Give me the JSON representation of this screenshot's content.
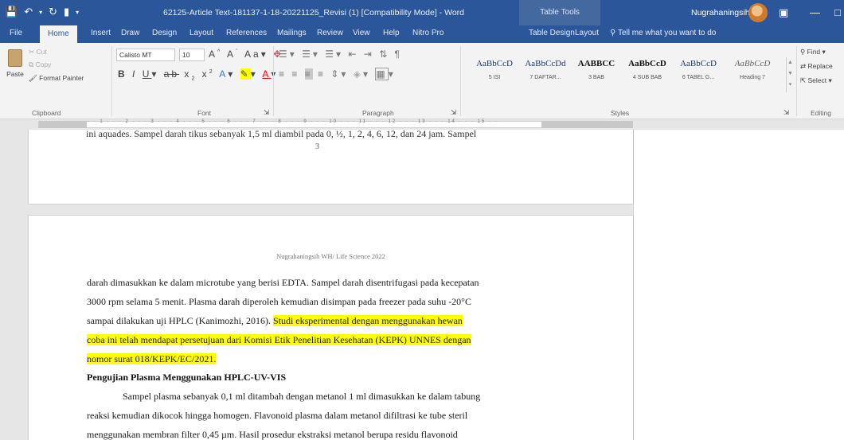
{
  "titlebar": {
    "document_title": "62125-Article Text-181137-1-18-20221125_Revisi (1) [Compatibility Mode] - Word",
    "table_tools": "Table Tools",
    "user_name": "Nugrahaningsih WH"
  },
  "tabs": [
    "File",
    "Home",
    "Insert",
    "Draw",
    "Design",
    "Layout",
    "References",
    "Mailings",
    "Review",
    "View",
    "Help",
    "Nitro Pro",
    "Table Design",
    "Layout"
  ],
  "active_tab": "Home",
  "tell_me": "Tell me what you want to do",
  "clipboard": {
    "paste": "Paste",
    "cut": "Cut",
    "copy": "Copy",
    "format_painter": "Format Painter",
    "label": "Clipboard"
  },
  "font": {
    "name": "Calisto MT",
    "size": "10",
    "label": "Font"
  },
  "paragraph": {
    "label": "Paragraph"
  },
  "styles": {
    "label": "Styles",
    "items": [
      {
        "sample": "AaBbCcD",
        "name": "5 ISI"
      },
      {
        "sample": "AaBbCcDd",
        "name": "7 DAFTAR..."
      },
      {
        "sample": "AABBCC",
        "name": "3 BAB"
      },
      {
        "sample": "AaBbCcD",
        "name": "4 SUB BAB"
      },
      {
        "sample": "AaBbCcD",
        "name": "6 TABEL G..."
      },
      {
        "sample": "AaBbCcD",
        "name": "Heading 7"
      }
    ]
  },
  "editing": {
    "find": "Find",
    "replace": "Replace",
    "select": "Select",
    "label": "Editing"
  },
  "document": {
    "page1_fragment": "ini aquades. Sampel darah tikus sebanyak 1,5 ml diambil pada 0, ½, 1, 2, 4, 6, 12, dan 24 jam. Sampel",
    "page1_number": "3",
    "header": "Nugrahaningsih WH/ Life Science 2022",
    "lines": [
      "darah dimasukkan ke dalam microtube yang berisi EDTA. Sampel darah disentrifugasi pada kecepatan",
      "3000 rpm selama 5 menit. Plasma darah diperoleh kemudian disimpan pada freezer pada suhu -20°C"
    ],
    "line3_plain": "sampai dilakukan uji HPLC (Kanimozhi, 2016).",
    "line3_highlight": "Studi eksperimental dengan menggunakan hewan",
    "line4_highlight": "coba ini telah mendapat persetujuan dari Komisi Etik Penelitian Kesehatan (KEPK) UNNES dengan",
    "line5_highlight": "nomor surat 018/KEPK/EC/2021.",
    "subheading": "Pengujian Plasma Menggunakan HPLC-UV-VIS",
    "para_lines": [
      "Sampel plasma sebanyak 0,1 ml ditambah dengan metanol 1 ml dimasukkan ke dalam tabung",
      "reaksi kemudian dikocok hingga homogen. Flavonoid plasma dalam metanol difiltrasi ke tube steril",
      "menggunakan membran filter 0,45 µm. Hasil prosedur ekstraksi metanol berupa residu flavonoid"
    ]
  },
  "colors": {
    "word_blue": "#2b579a",
    "highlight": "#ffff00"
  }
}
